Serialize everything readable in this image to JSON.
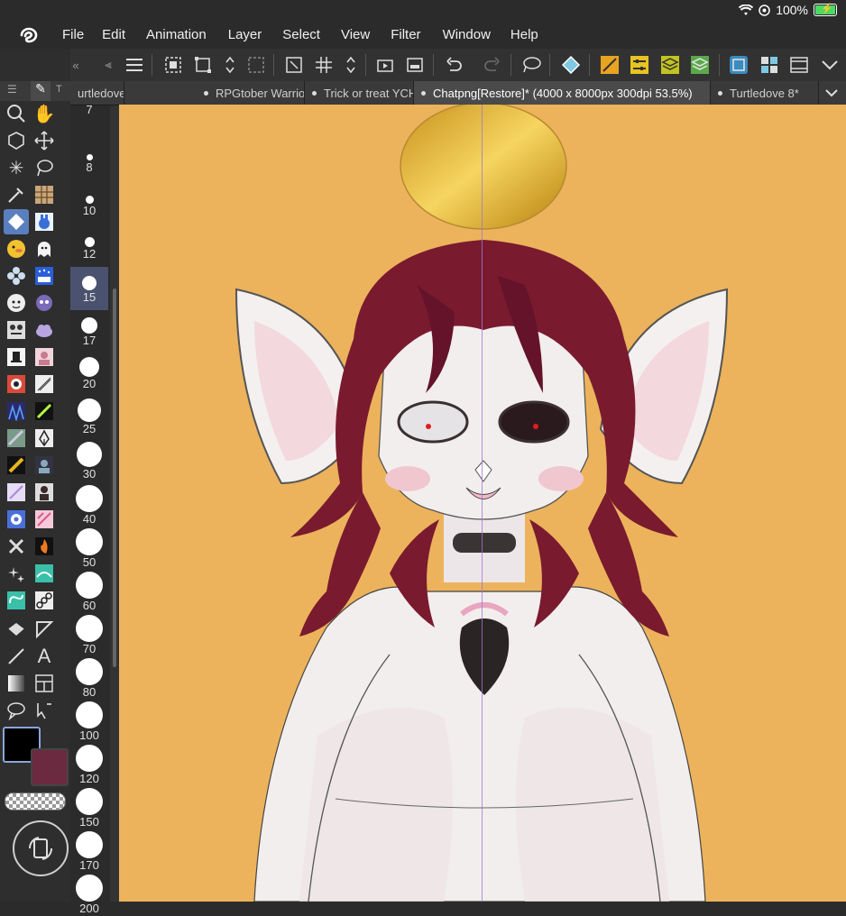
{
  "status": {
    "battery": "100%",
    "battery_level": 1.0
  },
  "menu": [
    "File",
    "Edit",
    "Animation",
    "Layer",
    "Select",
    "View",
    "Filter",
    "Window",
    "Help"
  ],
  "tabs": [
    {
      "label": "urtledove[Restore]",
      "active": false
    },
    {
      "label": "RPGtober Warrior",
      "active": false
    },
    {
      "label": "Trick or treat YCH",
      "active": false
    },
    {
      "label": "Chatpng[Restore]* (4000 x 8000px 300dpi 53.5%)",
      "active": true
    },
    {
      "label": "Turtledove 8*",
      "active": false
    }
  ],
  "brush_sizes": [
    "7",
    "8",
    "10",
    "12",
    "15",
    "17",
    "20",
    "25",
    "30",
    "40",
    "50",
    "60",
    "70",
    "80",
    "100",
    "120",
    "150",
    "170",
    "200"
  ],
  "selected_size": "15",
  "colors": {
    "main": "#000000",
    "sub": "#6b2a3f",
    "canvas_bg": "#ecb35c",
    "hair": "#7a1a2e"
  },
  "icons": {
    "toolbar": [
      "menu-icon",
      "select-layer-icon",
      "transform-icon",
      "flip-icon",
      "deselect-icon",
      "expand-icon",
      "grid-icon",
      "flip-vertical-icon",
      "animation-icon",
      "timeline-icon",
      "undo-icon",
      "redo-icon",
      "lasso-icon",
      "fill-icon",
      "ruler-icon",
      "adjust-icon",
      "layers-icon",
      "material-icon",
      "export-icon",
      "view-icon",
      "film-icon",
      "chevron-down-icon"
    ]
  }
}
